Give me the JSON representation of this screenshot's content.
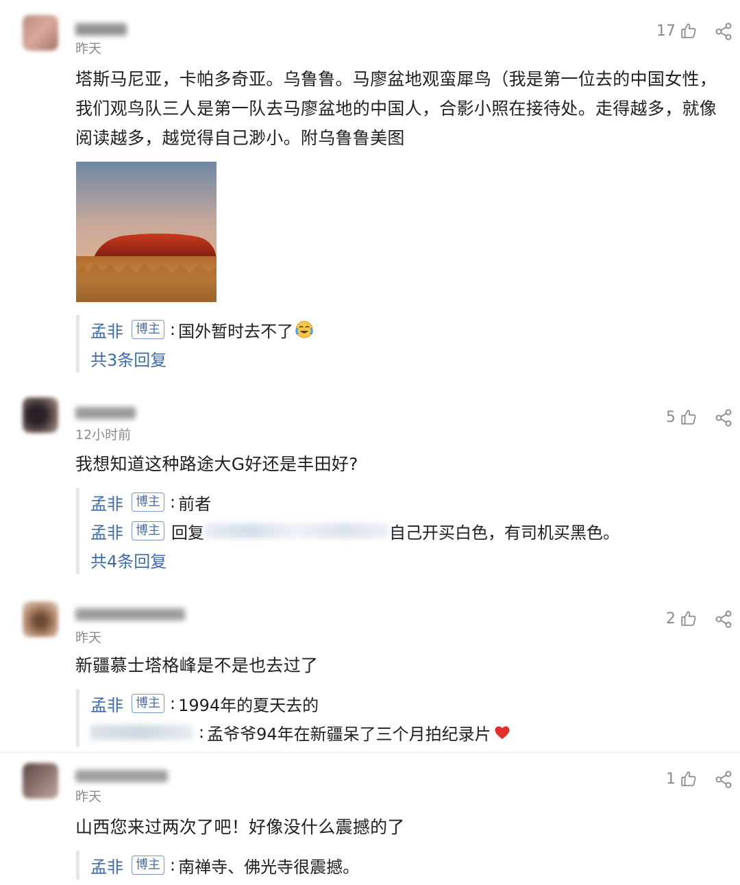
{
  "colors": {
    "link_blue": "#3d6aa8",
    "muted": "#8a8a8a",
    "heart": "#e0312f"
  },
  "comments": [
    {
      "time": "昨天",
      "likes": "17",
      "text": "塔斯马尼亚，卡帕多奇亚。乌鲁鲁。马廖盆地观蛮犀鸟（我是第一位去的中国女性，我们观鸟队三人是第一队去马廖盆地的中国人，合影小照在接待处。走得越多，就像阅读越多，越觉得自己渺小。附乌鲁鲁美图",
      "image_icon": "uluru-photo",
      "replies": [
        {
          "name": "孟非",
          "badge": "博主",
          "text": "国外暂时去不了",
          "emoji": "crying-laughing-emoji"
        }
      ],
      "more": "共3条回复"
    },
    {
      "time": "12小时前",
      "likes": "5",
      "text": "我想知道这种路途大G好还是丰田好?",
      "replies": [
        {
          "name": "孟非",
          "badge": "博主",
          "text": "前者"
        },
        {
          "name": "孟非",
          "badge": "博主",
          "prefix": "回复",
          "text": "自己开买白色，有司机买黑色。"
        }
      ],
      "more": "共4条回复"
    },
    {
      "time": "昨天",
      "likes": "2",
      "text": "新疆慕士塔格峰是不是也去过了",
      "replies": [
        {
          "name": "孟非",
          "badge": "博主",
          "text": "1994年的夏天去的"
        },
        {
          "text": "孟爷爷94年在新疆呆了三个月拍纪录片",
          "emoji": "heart-emoji"
        }
      ]
    },
    {
      "time": "昨天",
      "likes": "1",
      "text": "山西您来过两次了吧！好像没什么震撼的了",
      "replies": [
        {
          "name": "孟非",
          "badge": "博主",
          "text": "南禅寺、佛光寺很震撼。"
        }
      ]
    }
  ]
}
